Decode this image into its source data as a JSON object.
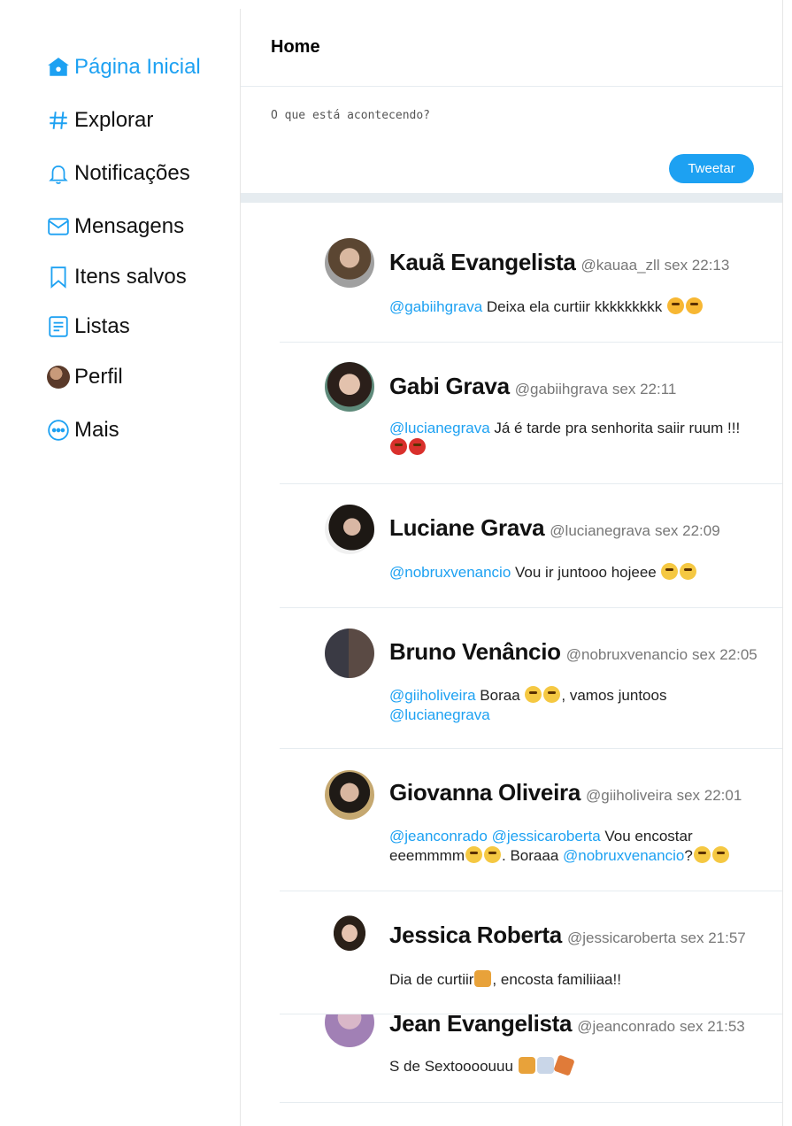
{
  "sidebar": {
    "items": [
      {
        "label": "Página Inicial",
        "icon": "home-icon",
        "active": true
      },
      {
        "label": "Explorar",
        "icon": "hashtag-icon"
      },
      {
        "label": "Notificações",
        "icon": "bell-icon"
      },
      {
        "label": "Mensagens",
        "icon": "mail-icon"
      },
      {
        "label": "Itens salvos",
        "icon": "bookmark-icon"
      },
      {
        "label": "Listas",
        "icon": "list-icon"
      },
      {
        "label": "Perfil",
        "icon": "profile-avatar"
      },
      {
        "label": "Mais",
        "icon": "more-icon"
      }
    ]
  },
  "header": {
    "title": "Home"
  },
  "compose": {
    "placeholder": "O que está acontecendo?",
    "button_label": "Tweetar"
  },
  "colors": {
    "accent": "#1da1f2",
    "divider": "#e6ecf0"
  },
  "tweets": [
    {
      "name": "Kauã Evangelista",
      "handle": "@kauaa_zll",
      "time": "sex 22:13",
      "mention1": "@gabiihgrava",
      "text1": " Deixa ela curtiir kkkkkkkkk "
    },
    {
      "name": "Gabi Grava",
      "handle": "@gabiihgrava",
      "time": "sex 22:11",
      "mention1": "@lucianegrava",
      "text1": " Já é tarde pra senhorita saiir ruum !!!"
    },
    {
      "name": "Luciane Grava",
      "handle": "@lucianegrava",
      "time": "sex 22:09",
      "mention1": "@nobruxvenancio",
      "text1": " Vou ir juntooo hojeee "
    },
    {
      "name": "Bruno Venâncio",
      "handle": "@nobruxvenancio",
      "time": "sex 22:05",
      "mention1": "@giiholiveira",
      "text1": " Boraa ",
      "text2": ", vamos juntoos",
      "mention2": "@lucianegrava"
    },
    {
      "name": "Giovanna Oliveira",
      "handle": "@giiholiveira",
      "time": "sex 22:01",
      "mention1": "@jeanconrado",
      "mention2": "@jessicaroberta",
      "text1": " Vou encostar",
      "text2": "eeemmmm",
      "text3": ". Boraaa ",
      "mention3": "@nobruxvenancio",
      "text4": "?"
    },
    {
      "name": "Jessica Roberta",
      "handle": "@jessicaroberta",
      "time": "sex 21:57",
      "text1": "Dia de curtiir",
      "text2": ", encosta familiiaa!!"
    },
    {
      "name": "Jean Evangelista",
      "handle": "@jeanconrado",
      "time": "sex 21:53",
      "text1": "S de Sextoooouuu "
    }
  ]
}
